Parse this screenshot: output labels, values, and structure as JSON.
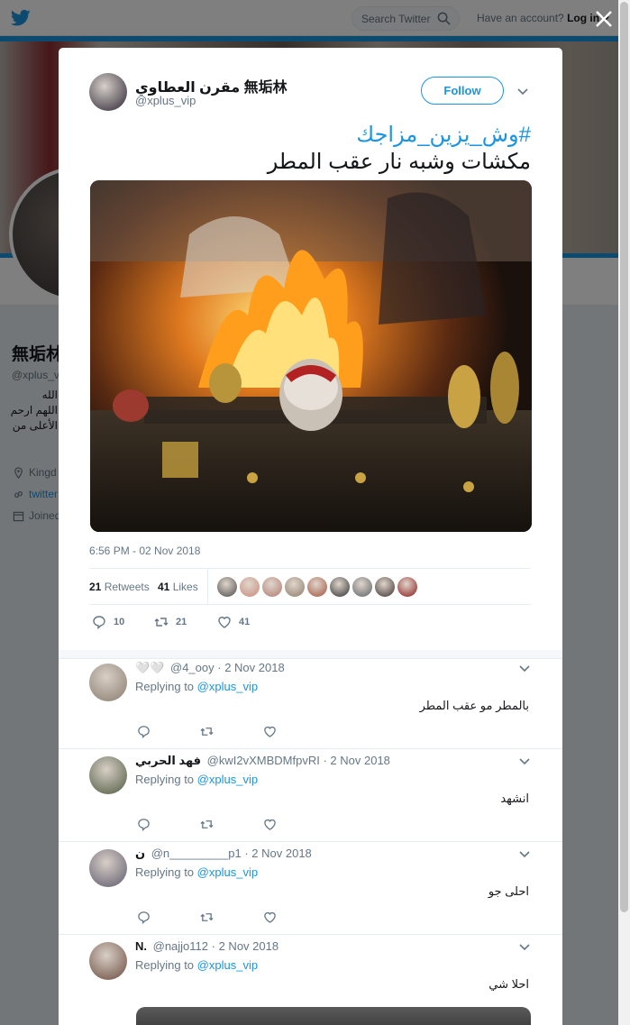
{
  "topbar": {
    "search_placeholder": "Search Twitter",
    "account_text": "Have an account?",
    "login_label": "Log in"
  },
  "background_profile": {
    "name": "無垢林",
    "handle": "@xplus_v",
    "bio_lines": [
      "الله",
      "اللهم ارحم",
      "الأعلى من"
    ],
    "location": "Kingd",
    "website": "twitter",
    "joined": "Joined"
  },
  "tweet": {
    "author_name": "مقرن العطاوي 無垢林",
    "author_handle": "@xplus_vip",
    "follow_label": "Follow",
    "hashtag": "#وش_يزين_مزاجك",
    "text": "مكشات وشبه نار عقب المطر",
    "timestamp": "6:56 PM - 02 Nov 2018",
    "retweets_count": "21",
    "retweets_label": "Retweets",
    "likes_count": "41",
    "likes_label": "Likes",
    "actions": {
      "replies": "10",
      "retweets": "21",
      "likes": "41"
    },
    "liker_avatar_colors": [
      "#4a4a4a",
      "#c98a7a",
      "#b07a70",
      "#8c7a6a",
      "#a0523d",
      "#2f2f2f",
      "#5c5f66",
      "#3a2f2c",
      "#8b1a1a"
    ]
  },
  "replies": [
    {
      "name": "🤍🤍",
      "handle": "@4_ooy",
      "date": "2 Nov 2018",
      "replying_label": "Replying to",
      "replying_to": "@xplus_vip",
      "text": "بالمطر مو عقب المطر",
      "avatar_color": "#8a7c6e"
    },
    {
      "name": "فهد الحربي",
      "handle": "@kwI2vXMBDMfpvRI",
      "date": "2 Nov 2018",
      "replying_label": "Replying to",
      "replying_to": "@xplus_vip",
      "text": "انشهد",
      "avatar_color": "#4d5a3e"
    },
    {
      "name": "ن",
      "handle": "@n_________p1",
      "date": "2 Nov 2018",
      "replying_label": "Replying to",
      "replying_to": "@xplus_vip",
      "text": "احلى جو",
      "avatar_color": "#5e5a6e"
    },
    {
      "name": "N.",
      "handle": "@najjo112",
      "date": "2 Nov 2018",
      "replying_label": "Replying to",
      "replying_to": "@xplus_vip",
      "text": "احلا شي",
      "avatar_color": "#6b4b3e"
    }
  ],
  "colors": {
    "accent": "#1b95e0",
    "text_secondary": "#657786",
    "overlay": "rgba(0,0,0,0.5)"
  }
}
